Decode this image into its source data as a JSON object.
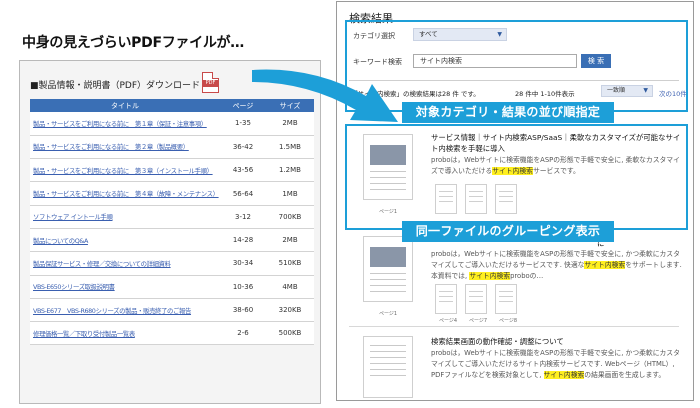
{
  "headline": "中身の見えづらいPDFファイルが…",
  "pdf_list": {
    "heading": "■製品情報・説明書（PDF）ダウンロード",
    "pdf_badge": "PDF",
    "columns": [
      "タイトル",
      "ページ",
      "サイズ"
    ],
    "rows": [
      {
        "title": "製品・サービスをご利用になる前に　第１章（保証・注意事項）",
        "pages": "1-35",
        "size": "2MB"
      },
      {
        "title": "製品・サービスをご利用になる前に　第２章（製品概要）",
        "pages": "36-42",
        "size": "1.5MB"
      },
      {
        "title": "製品・サービスをご利用になる前に　第３章（インストール手順）",
        "pages": "43-56",
        "size": "1.2MB"
      },
      {
        "title": "製品・サービスをご利用になる前に　第４章（故障・メンテナンス）",
        "pages": "56-64",
        "size": "1MB"
      },
      {
        "title": "ソフトウェア イントール手順",
        "pages": "3-12",
        "size": "700KB"
      },
      {
        "title": "製品についてのQ&A",
        "pages": "14-28",
        "size": "2MB"
      },
      {
        "title": "製品保証サービス・修理／交換についての詳細資料",
        "pages": "30-34",
        "size": "510KB"
      },
      {
        "title": "VBS-E650シリーズ取扱説明書",
        "pages": "10-36",
        "size": "4MB"
      },
      {
        "title": "VBS-E677　VBS-R680シリーズの製品・販売終了のご報告",
        "pages": "38-60",
        "size": "320KB"
      },
      {
        "title": "修理価格一覧／下取り受付製品一覧表",
        "pages": "2-6",
        "size": "500KB"
      }
    ]
  },
  "results": {
    "title": "検索結果",
    "category_label": "カテゴリ選択",
    "category_value": "すべて",
    "keyword_label": "キーワード検索",
    "keyword_value": "サイト内検索",
    "search_button": "検 索",
    "summary": "「サイト内検索」の検索結果は28 件 です。",
    "count": "28 件中 1-10件表示",
    "sort_value": "一致順",
    "next_link": "次の10件",
    "entries": [
      {
        "title": "サービス情報｜サイト内検索ASP/SaaS｜柔軟なカスタマイズが可能なサイト内検索を手軽に導入",
        "desc_pre": "proboは，Webサイトに検索機能をASPの形態で手軽で安全に, 柔軟なカスタマイズで導入いただける",
        "desc_mark": "サイト内検索",
        "desc_post": "サービスです。",
        "page_caption": "ページ1"
      },
      {
        "title_tail": "に",
        "desc_pre": "proboは，Webサイトに検索機能をASPの形態で手軽で安全に, かつ柔軟にカスタマイズしてご導入いただけるサービスです. 快適な",
        "desc_mark": "サイト内検索",
        "desc_mid": "をサポートします. 本資料では, ",
        "desc_mark2": "サイト内検索",
        "desc_post": "proboの…",
        "page_caption": "ページ1",
        "small_captions": [
          "ページ4",
          "ページ7",
          "ページ8"
        ]
      },
      {
        "title": "検索結果画面の動作確認・調整について",
        "desc_pre": "proboは，Webサイトに検索機能をASPの形態で手軽で安全に, かつ柔軟にカスタマイズしてご導入いただけるサイト内検索サービスです. Webページ（HTML）, PDFファイルなどを検索対象として, ",
        "desc_mark": "サイト内検索",
        "desc_post": "の結果画面を生成します。"
      }
    ]
  },
  "banners": {
    "sort": "対象カテゴリ・結果の並び順指定",
    "grouping": "同一ファイルのグルーピング表示"
  },
  "colors": {
    "accent": "#1d9fd8",
    "table_header": "#3a6fb5",
    "highlight": "#ffef1f"
  },
  "icons": {
    "pdf": "pdf-file-icon",
    "arrow": "curved-arrow-icon",
    "dropdown": "chevron-down-icon"
  }
}
